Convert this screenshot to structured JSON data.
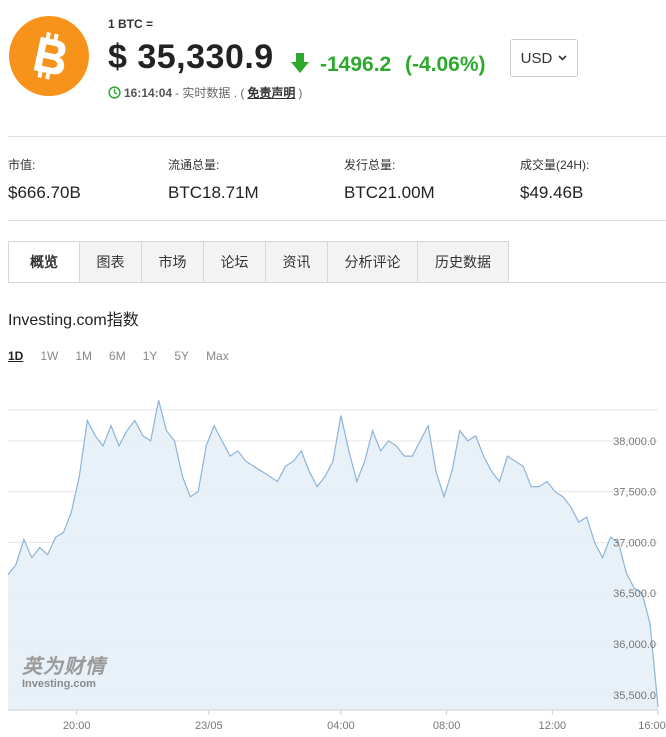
{
  "header": {
    "unit_label": "1 BTC =",
    "price": "$ 35,330.9",
    "change_abs": "-1496.2",
    "change_pct": "(-4.06%)",
    "time": "16:14:04",
    "realtime": "- 实时数据 . (",
    "disclaimer": "免责声明",
    "close_paren": ")",
    "currency": "USD",
    "logo_icon": "bitcoin-logo",
    "arrow_icon": "arrow-down-icon",
    "clock_icon": "clock-icon",
    "colors": {
      "logo": "#f7931a",
      "down": "#2daa2d"
    }
  },
  "stats": [
    {
      "label": "市值:",
      "value": "$666.70B"
    },
    {
      "label": "流通总量:",
      "value": "BTC18.71M"
    },
    {
      "label": "发行总量:",
      "value": "BTC21.00M"
    },
    {
      "label": "成交量(24H):",
      "value": "$49.46B"
    }
  ],
  "tabs": [
    "概览",
    "图表",
    "市场",
    "论坛",
    "资讯",
    "分析评论",
    "历史数据"
  ],
  "chart_section": {
    "title": "Investing.com指数",
    "ranges": [
      "1D",
      "1W",
      "1M",
      "6M",
      "1Y",
      "5Y",
      "Max"
    ],
    "active_range": "1D",
    "watermark_cn": "英为财情",
    "watermark_en": "Investing.com"
  },
  "chart_data": {
    "type": "area",
    "x_labels": [
      "20:00",
      "23/05",
      "04:00",
      "08:00",
      "12:00",
      "16:00"
    ],
    "y_ticks": [
      "38,000.0",
      "37,500.0",
      "37,000.0",
      "36,500.0",
      "36,000.0",
      "35,500.0"
    ],
    "y_tick_values": [
      38000,
      37500,
      37000,
      36500,
      36000,
      35500
    ],
    "ylim": [
      35350,
      38550
    ],
    "xlim": [
      0,
      24.6
    ],
    "x_tick_values": [
      2.6,
      7.6,
      12.6,
      16.6,
      20.6,
      24.6
    ],
    "x": [
      0,
      0.3,
      0.6,
      0.9,
      1.2,
      1.5,
      1.8,
      2.1,
      2.4,
      2.7,
      3.0,
      3.3,
      3.6,
      3.9,
      4.2,
      4.5,
      4.8,
      5.1,
      5.4,
      5.7,
      6.0,
      6.3,
      6.6,
      6.9,
      7.2,
      7.5,
      7.8,
      8.1,
      8.4,
      8.7,
      9.0,
      9.3,
      9.6,
      9.9,
      10.2,
      10.5,
      10.8,
      11.1,
      11.4,
      11.7,
      12.0,
      12.3,
      12.6,
      12.9,
      13.2,
      13.5,
      13.8,
      14.1,
      14.4,
      14.7,
      15.0,
      15.3,
      15.6,
      15.9,
      16.2,
      16.5,
      16.8,
      17.1,
      17.4,
      17.7,
      18.0,
      18.3,
      18.6,
      18.9,
      19.2,
      19.5,
      19.8,
      20.1,
      20.4,
      20.7,
      21.0,
      21.3,
      21.6,
      21.9,
      22.2,
      22.5,
      22.8,
      23.1,
      23.4,
      23.7,
      24.0,
      24.3,
      24.6
    ],
    "y": [
      36680,
      36780,
      37030,
      36850,
      36950,
      36880,
      37050,
      37100,
      37300,
      37650,
      38200,
      38050,
      37950,
      38150,
      37950,
      38100,
      38200,
      38050,
      38000,
      38400,
      38100,
      38000,
      37650,
      37450,
      37500,
      37950,
      38150,
      38000,
      37850,
      37900,
      37800,
      37750,
      37700,
      37650,
      37600,
      37750,
      37800,
      37900,
      37700,
      37550,
      37650,
      37800,
      38250,
      37900,
      37600,
      37800,
      38100,
      37900,
      38000,
      37950,
      37850,
      37850,
      38000,
      38150,
      37700,
      37450,
      37700,
      38100,
      38000,
      38050,
      37850,
      37700,
      37600,
      37850,
      37800,
      37750,
      37550,
      37550,
      37600,
      37500,
      37450,
      37350,
      37200,
      37250,
      37000,
      36850,
      37050,
      37000,
      36700,
      36550,
      36500,
      36200,
      35380
    ],
    "title": "",
    "xlabel": "",
    "ylabel": "",
    "grid": true,
    "colors": {
      "line": "#8db4d9",
      "fill": "#e4eef7",
      "grid": "#e6e6e6",
      "axis_text": "#777"
    }
  }
}
